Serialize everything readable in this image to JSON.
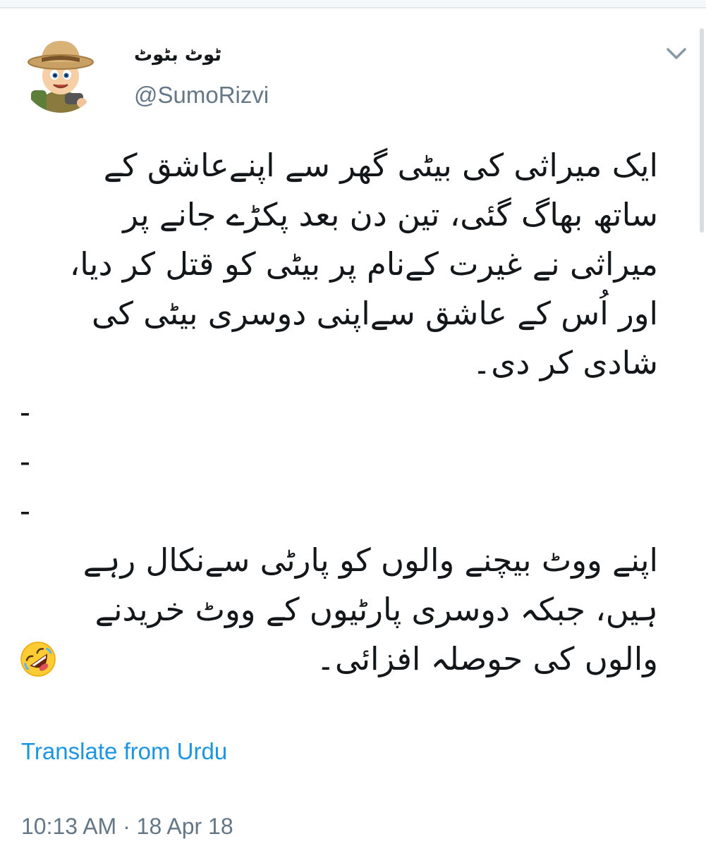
{
  "tweet": {
    "display_name": "ٹوٹ بٹوٹ",
    "handle": "@SumoRizvi",
    "menu_icon": "chevron-down-icon",
    "avatar_icon": "cartoon-explorer-boy-avatar",
    "text_lines": [
      "ایک میراثی کی بیٹی گھر سے اپنےعاشق کے",
      "ساتھ بھاگ گئی، تین دن بعد پکڑے جانے پر",
      "میراثی نے غیرت کےنام پر بیٹی کو قتل کر دیا،",
      "اور اُس کے عاشق سےاپنی دوسری بیٹی کی",
      "شادی کر دی۔",
      "-",
      "-",
      "-",
      "اپنے ووٹ بیچنے والوں کو پارٹی سےنکال رہے",
      "ہیں، جبکہ دوسری پارٹیوں کے ووٹ خریدنے",
      "والوں کی حوصلہ افزائی۔"
    ],
    "emoji_icon": "rolling-on-floor-laughing-emoji",
    "translate_label": "Translate from Urdu",
    "timestamp": "10:13 AM · 18 Apr 18"
  },
  "colors": {
    "text": "#14171a",
    "secondary": "#657786",
    "link": "#1b95e0"
  }
}
